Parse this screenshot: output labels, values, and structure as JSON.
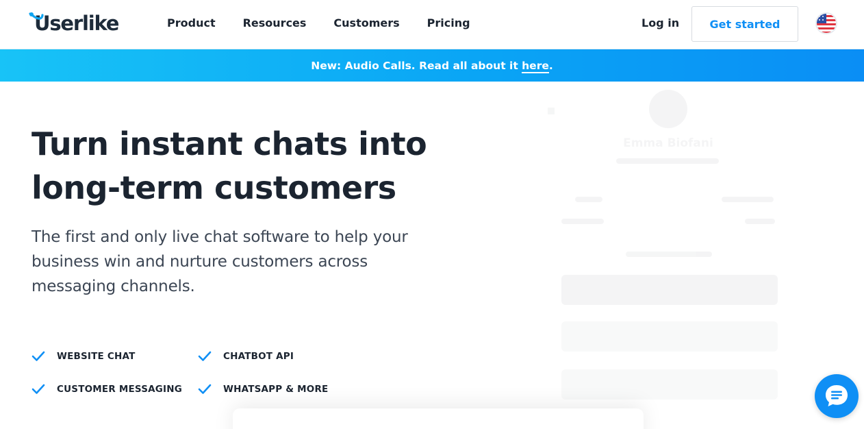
{
  "header": {
    "logo_text": "Userlike",
    "nav": [
      {
        "label": "Product"
      },
      {
        "label": "Resources"
      },
      {
        "label": "Customers"
      },
      {
        "label": "Pricing"
      }
    ],
    "login_label": "Log in",
    "cta_label": "Get started",
    "language_icon": "us-flag-icon"
  },
  "banner": {
    "text_before": "New: Audio Calls. Read all about it ",
    "link_label": "here",
    "text_after": "."
  },
  "hero": {
    "title": "Turn instant chats into long-term customers",
    "subtitle": "The first and only live chat software to help your business win and nurture customers across messaging channels."
  },
  "features": [
    {
      "label": "WEBSITE CHAT"
    },
    {
      "label": "CHATBOT API"
    },
    {
      "label": "CUSTOMER MESSAGING"
    },
    {
      "label": "WHATSAPP & MORE"
    }
  ],
  "preview": {
    "agent_name": "Emma Biofani"
  },
  "chat_widget": {
    "icon": "chat-bubble-icon"
  },
  "colors": {
    "brand_blue": "#0f8ff5",
    "banner_start": "#18c3f7",
    "banner_end": "#0a8ef5",
    "text_dark": "#1b2430"
  }
}
